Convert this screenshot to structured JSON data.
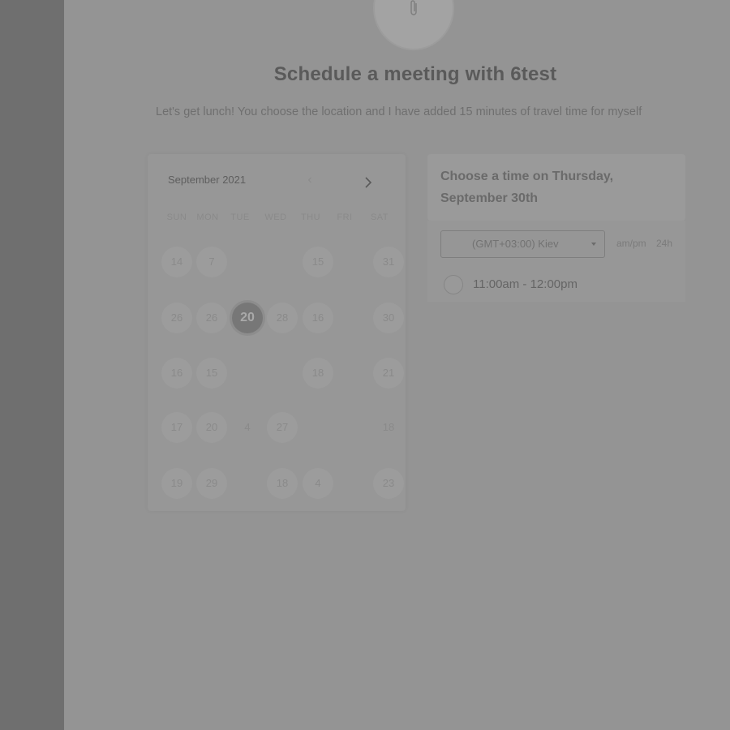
{
  "header": {
    "title": "Schedule a meeting with 6test",
    "subtitle": "Let's get lunch! You choose the location and I have added 15 minutes of travel time for myself"
  },
  "calendar": {
    "month_label": "September 2021",
    "prev_icon": "chevron-left-icon",
    "next_icon": "chevron-right-icon",
    "weekdays": [
      "SUN",
      "MON",
      "TUE",
      "WED",
      "THU",
      "FRI",
      "SAT"
    ],
    "selected_day": "20",
    "days": [
      "14",
      "7",
      "15",
      "31",
      "26",
      "26",
      "20",
      "28",
      "16",
      "30",
      "16",
      "15",
      "18",
      "21",
      "17",
      "20",
      "4",
      "27",
      "18",
      "19",
      "29",
      "18",
      "4",
      "23"
    ]
  },
  "time_panel": {
    "heading": "Choose a time on Thursday, September 30th",
    "timezone": "(GMT+03:00) Kiev",
    "format_ampm": "am/pm",
    "format_24h": "24h",
    "slots": [
      "11:00am - 12:00pm"
    ]
  },
  "colors": {
    "overlay_bg": "#949494",
    "left_strip": "#6f6f6f"
  }
}
